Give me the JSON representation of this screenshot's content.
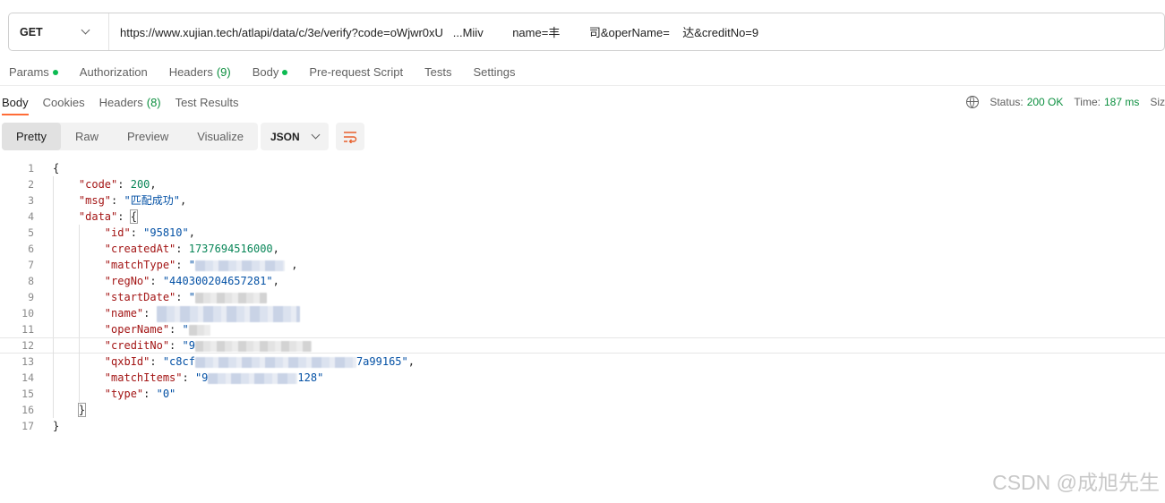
{
  "request": {
    "method": "GET",
    "url": "https://www.xujian.tech/atlapi/data/c/3e/verify?code=oWjwr0xU   ...Miiv         name=丰         司&operName=    达&creditNo=9"
  },
  "request_tabs": [
    {
      "label": "Params",
      "dot": true
    },
    {
      "label": "Authorization"
    },
    {
      "label": "Headers",
      "count": "(9)"
    },
    {
      "label": "Body",
      "dot": true
    },
    {
      "label": "Pre-request Script"
    },
    {
      "label": "Tests"
    },
    {
      "label": "Settings"
    }
  ],
  "response_tabs": [
    {
      "label": "Body"
    },
    {
      "label": "Cookies"
    },
    {
      "label": "Headers",
      "count": "(8)"
    },
    {
      "label": "Test Results"
    }
  ],
  "status": {
    "status_label": "Status:",
    "status_value": "200 OK",
    "time_label": "Time:",
    "time_value": "187 ms",
    "size_label": "Siz"
  },
  "view_modes": [
    "Pretty",
    "Raw",
    "Preview",
    "Visualize"
  ],
  "format": "JSON",
  "json_lines": {
    "l1": "{",
    "code_key": "\"code\"",
    "code_val": "200",
    "msg_key": "\"msg\"",
    "msg_val": "\"匹配成功\"",
    "data_key": "\"data\"",
    "data_brace": "{",
    "id_key": "\"id\"",
    "id_val": "\"95810\"",
    "created_key": "\"createdAt\"",
    "created_val": "1737694516000",
    "matchtype_key": "\"matchType\"",
    "matchtype_val": "\"",
    "regno_key": "\"regNo\"",
    "regno_val": "\"440300204657281\"",
    "startdate_key": "\"startDate\"",
    "startdate_val": "\"",
    "name_key": "\"name\"",
    "opername_key": "\"operName\"",
    "opername_val": "\"",
    "creditno_key": "\"creditNo\"",
    "creditno_val": "\"9",
    "qxbid_key": "\"qxbId\"",
    "qxbid_val_start": "\"c8cf",
    "qxbid_val_end": "7a99165\"",
    "matchitems_key": "\"matchItems\"",
    "matchitems_val_start": "\"9",
    "matchitems_val_end": "128\"",
    "type_key": "\"type\"",
    "type_val": "\"0\"",
    "close_data": "}",
    "close_root": "}"
  },
  "line_numbers": [
    "1",
    "2",
    "3",
    "4",
    "5",
    "6",
    "7",
    "8",
    "9",
    "10",
    "11",
    "12",
    "13",
    "14",
    "15",
    "16",
    "17"
  ],
  "watermark": "CSDN @成旭先生"
}
